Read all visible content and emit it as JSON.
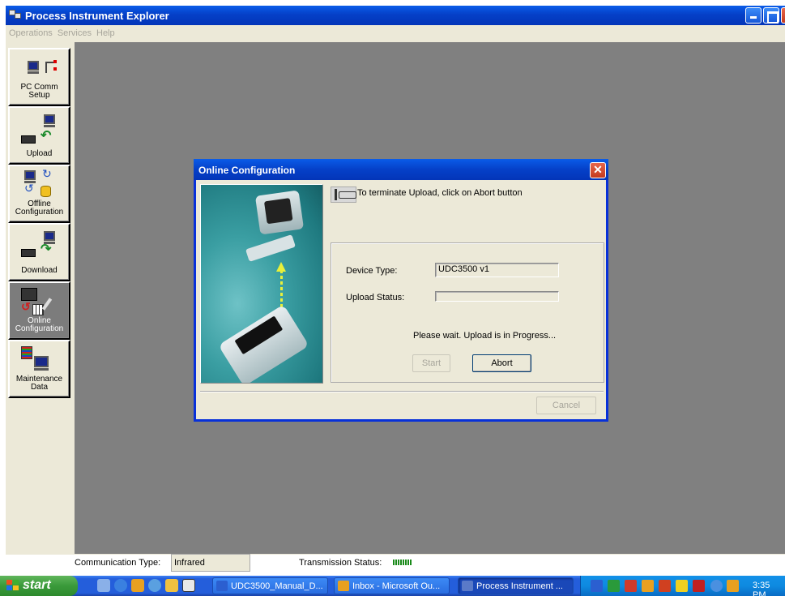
{
  "window": {
    "title": "Process Instrument Explorer"
  },
  "menu": [
    "Operations",
    "Services",
    "Help"
  ],
  "toolbar": [
    {
      "id": "pc-comm-setup",
      "label_lines": [
        "PC Comm",
        "Setup"
      ]
    },
    {
      "id": "upload",
      "label_lines": [
        "Upload"
      ]
    },
    {
      "id": "offline-configuration",
      "label_lines": [
        "Offline",
        "Configuration"
      ]
    },
    {
      "id": "download",
      "label_lines": [
        "Download"
      ]
    },
    {
      "id": "online-configuration",
      "label_lines": [
        "Online",
        "Configuration"
      ],
      "active": true
    },
    {
      "id": "maintenance-data",
      "label_lines": [
        "Maintenance",
        "Data"
      ]
    }
  ],
  "dialog": {
    "title": "Online Configuration",
    "hint": "To terminate Upload, click on Abort button",
    "device_type_label": "Device Type:",
    "device_type_value": "UDC3500  v1",
    "upload_status_label": "Upload Status:",
    "upload_status_value": "",
    "message": "Please wait. Upload is in Progress...",
    "start_label": "Start",
    "abort_label": "Abort",
    "cancel_label": "Cancel"
  },
  "status": {
    "comm_type_label": "Communication Type:",
    "comm_type_value": "Infrared",
    "tx_status_label": "Transmission Status:"
  },
  "taskbar": {
    "start_label": "start",
    "tasks": [
      {
        "label": "UDC3500_Manual_D...",
        "icon_color": "#2b5fd0"
      },
      {
        "label": "Inbox - Microsoft Ou...",
        "icon_color": "#e8a020"
      },
      {
        "label": "Process Instrument ...",
        "icon_color": "#5a7ac8",
        "active": true
      }
    ],
    "clock": "3:35 PM"
  }
}
